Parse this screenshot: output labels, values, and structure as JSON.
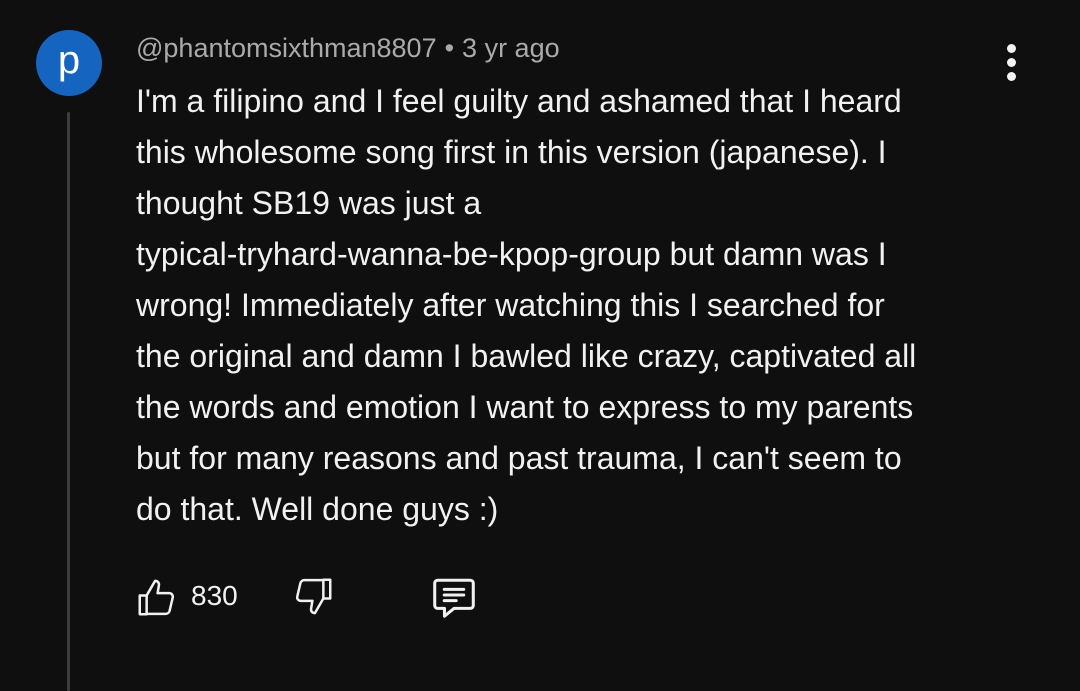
{
  "comment": {
    "avatar_letter": "p",
    "avatar_color": "#1565c0",
    "author": "@phantomsixthman8807",
    "separator": "•",
    "timestamp": "3 yr ago",
    "text_lines": [
      "I'm a filipino and I feel guilty and ashamed that I heard",
      "this wholesome song first in this version (japanese). I",
      "thought SB19 was just a",
      "typical-tryhard-wanna-be-kpop-group but damn was I",
      "wrong! Immediately after watching this I searched for",
      "the original and damn I bawled like crazy, captivated all",
      "the words and emotion I want to express to my parents",
      "but for many reasons and past trauma, I can't seem to",
      "do that. Well done guys :)"
    ],
    "like_count": "830"
  },
  "icons": {
    "menu": "more-vertical-icon",
    "like": "thumbs-up-icon",
    "dislike": "thumbs-down-icon",
    "reply": "comment-reply-icon"
  },
  "colors": {
    "background": "#0f0f0f",
    "text_primary": "#f1f1f1",
    "text_secondary": "#aaaaaa",
    "thread_line": "#3d3d3d"
  }
}
